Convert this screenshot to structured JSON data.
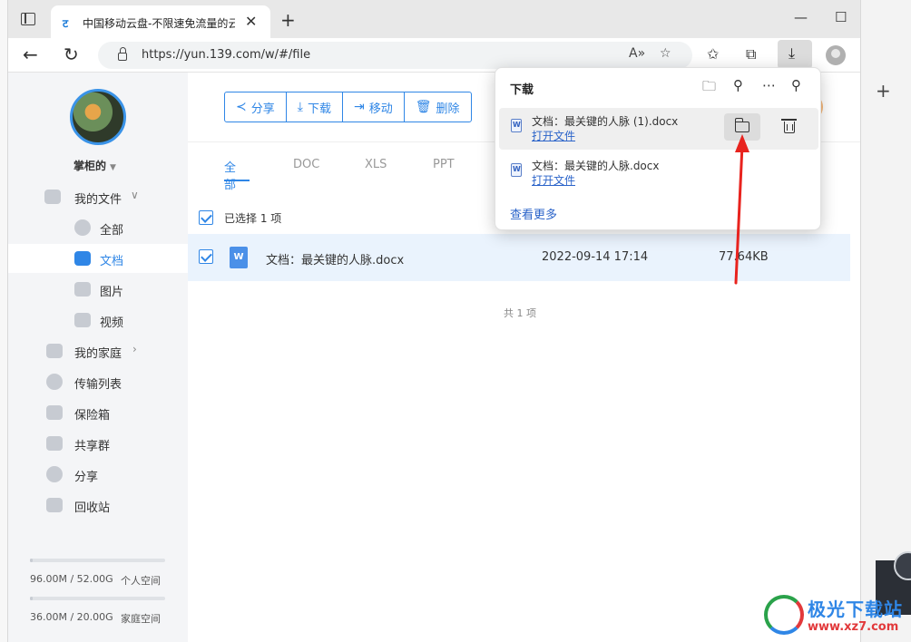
{
  "browser": {
    "tab_title": "中国移动云盘-不限速免流量的云",
    "url": "https://yun.139.com/w/#/file",
    "accent": "#2f86e6"
  },
  "sidebar": {
    "username": "掌柜的",
    "nav": [
      {
        "label": "我的文件",
        "icon": "folder-cloud-icon"
      },
      {
        "label": "全部",
        "icon": "grid-icon"
      },
      {
        "label": "文档",
        "icon": "document-icon",
        "active": true
      },
      {
        "label": "图片",
        "icon": "image-icon"
      },
      {
        "label": "视频",
        "icon": "video-icon"
      },
      {
        "label": "我的家庭",
        "icon": "heart-icon"
      },
      {
        "label": "传输列表",
        "icon": "transfer-icon"
      },
      {
        "label": "保险箱",
        "icon": "safe-icon"
      },
      {
        "label": "共享群",
        "icon": "group-icon"
      },
      {
        "label": "分享",
        "icon": "share-icon"
      },
      {
        "label": "回收站",
        "icon": "trash-icon"
      }
    ],
    "storage": [
      {
        "text": "96.00M / 52.00G",
        "label": "个人空间",
        "used_fraction": 0.002
      },
      {
        "text": "36.00M / 20.00G",
        "label": "家庭空间",
        "used_fraction": 0.002
      }
    ]
  },
  "toolbar": {
    "share": "分享",
    "download": "下载",
    "move": "移动",
    "delete": "删除"
  },
  "type_tabs": [
    "全部",
    "DOC",
    "XLS",
    "PPT"
  ],
  "list": {
    "selected": "已选择 1 项",
    "file": {
      "icon_letter": "W",
      "name": "文档：最关键的人脉.docx",
      "date": "2022-09-14  17:14",
      "size": "77.64KB"
    },
    "total": "共 1 项"
  },
  "downloads": {
    "title": "下载",
    "items": [
      {
        "name": "文档：最关键的人脉 (1).docx",
        "open": "打开文件"
      },
      {
        "name": "文档：最关键的人脉.docx",
        "open": "打开文件"
      }
    ],
    "see_more": "查看更多"
  },
  "watermark": {
    "text": "极光下载站",
    "url": "www.xz7.com"
  }
}
